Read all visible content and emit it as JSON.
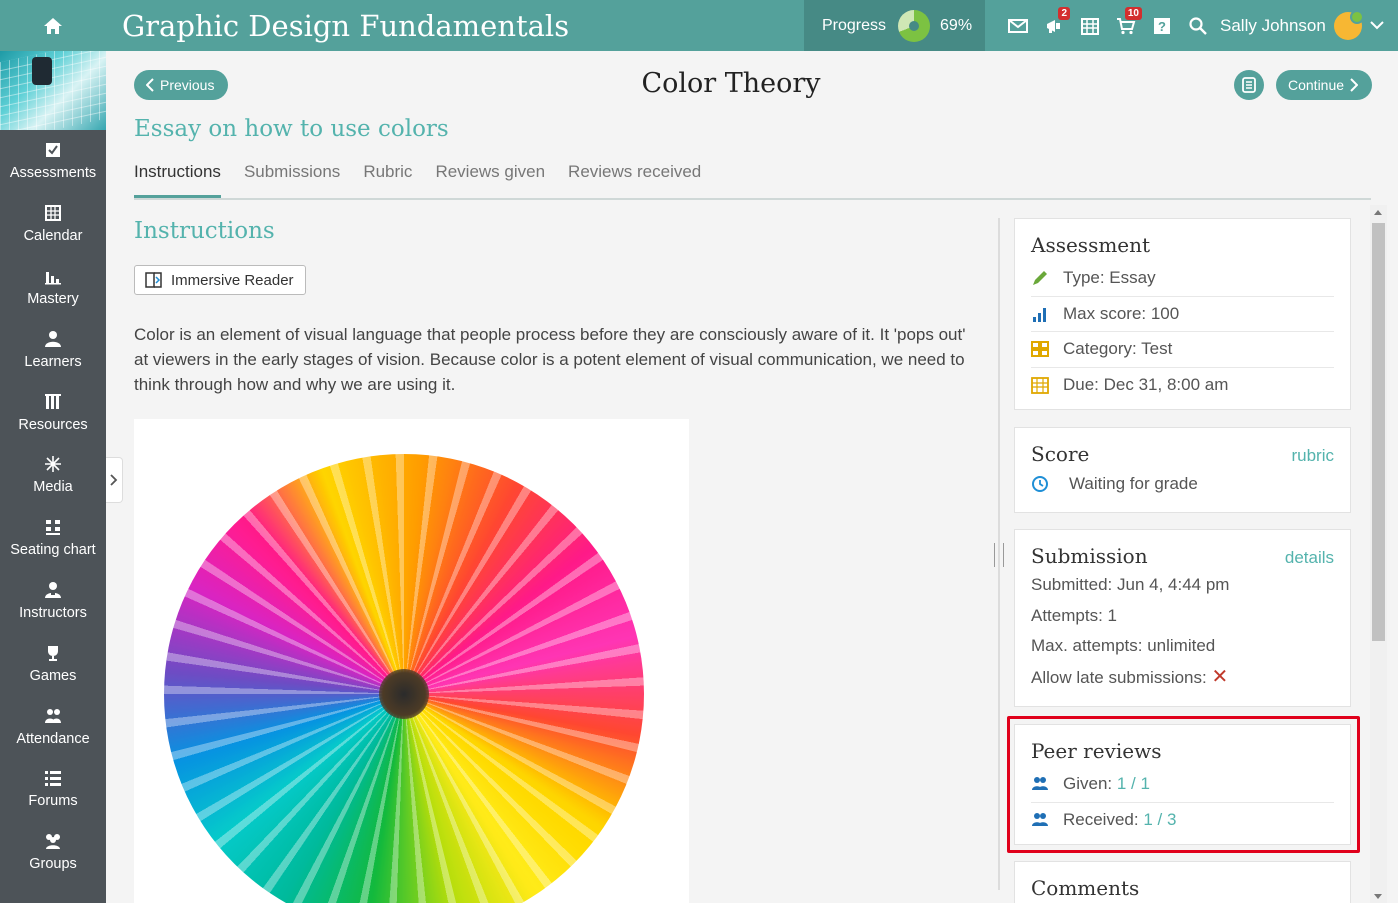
{
  "topbar": {
    "course_title": "Graphic Design Fundamentals",
    "progress_label": "Progress",
    "progress_value": "69%",
    "progress_fraction": 0.69,
    "notifications_badge": "2",
    "cart_badge": "10",
    "user_name": "Sally Johnson"
  },
  "sidebar": {
    "items": [
      {
        "label": "Assessments",
        "icon": "check-square-icon"
      },
      {
        "label": "Calendar",
        "icon": "calendar-icon"
      },
      {
        "label": "Mastery",
        "icon": "bar-chart-icon"
      },
      {
        "label": "Learners",
        "icon": "user-icon"
      },
      {
        "label": "Resources",
        "icon": "books-icon"
      },
      {
        "label": "Media",
        "icon": "sparkle-icon"
      },
      {
        "label": "Seating chart",
        "icon": "seating-grid-icon"
      },
      {
        "label": "Instructors",
        "icon": "instructor-icon"
      },
      {
        "label": "Games",
        "icon": "trophy-icon"
      },
      {
        "label": "Attendance",
        "icon": "attendance-icon"
      },
      {
        "label": "Forums",
        "icon": "list-icon"
      },
      {
        "label": "Groups",
        "icon": "group-icon"
      }
    ]
  },
  "header": {
    "previous_label": "Previous",
    "lesson_title": "Color Theory",
    "continue_label": "Continue"
  },
  "assignment": {
    "title": "Essay on how to use colors",
    "tabs": [
      "Instructions",
      "Submissions",
      "Rubric",
      "Reviews given",
      "Reviews received"
    ],
    "active_tab": "Instructions"
  },
  "instructions": {
    "heading": "Instructions",
    "reader_label": "Immersive Reader",
    "text": "Color is an element of visual language that people process before they are consciously aware of it. It 'pops out' at viewers in the early stages of vision. Because color is a potent element of visual communication, we need to think through how and why we are using it."
  },
  "assessment_card": {
    "title": "Assessment",
    "type": "Type: Essay",
    "max_score": "Max score: 100",
    "category": "Category: Test",
    "due": "Due: Dec 31, 8:00 am"
  },
  "score_card": {
    "title": "Score",
    "link": "rubric",
    "status": "Waiting for grade"
  },
  "submission_card": {
    "title": "Submission",
    "link": "details",
    "submitted": "Submitted: Jun 4, 4:44 pm",
    "attempts": "Attempts: 1",
    "max_attempts": "Max. attempts: unlimited",
    "late_label": "Allow late submissions:"
  },
  "peer_reviews_card": {
    "title": "Peer reviews",
    "given_label": "Given:",
    "given_value": "1 / 1",
    "received_label": "Received:",
    "received_value": "1 / 3"
  },
  "comments_card": {
    "title": "Comments"
  },
  "colors": {
    "brand": "#54a19b",
    "sidebar": "#4d5358",
    "accent_text": "#54b3ad",
    "highlight": "#e0001b"
  }
}
